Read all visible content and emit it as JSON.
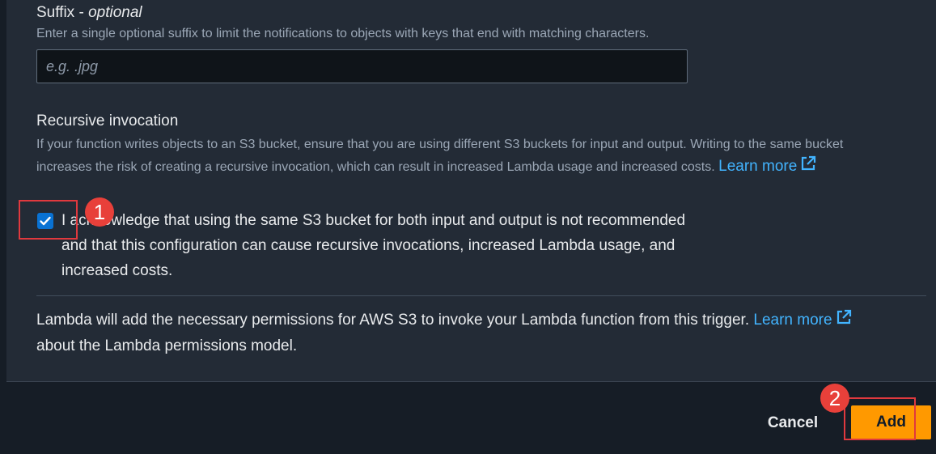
{
  "suffix": {
    "title": "Suffix - ",
    "title_optional": "optional",
    "description": "Enter a single optional suffix to limit the notifications to objects with keys that end with matching characters.",
    "placeholder": "e.g. .jpg",
    "value": ""
  },
  "recursive": {
    "title": "Recursive invocation",
    "description": "If your function writes objects to an S3 bucket, ensure that you are using different S3 buckets for input and output. Writing to the same bucket increases the risk of creating a recursive invocation, which can result in increased Lambda usage and increased costs.",
    "learn_more": "Learn more",
    "acknowledge_checked": true,
    "acknowledge_label": "I acknowledge that using the same S3 bucket for both input and output is not recommended and that this configuration can cause recursive invocations, increased Lambda usage, and increased costs."
  },
  "permissions": {
    "text_before": "Lambda will add the necessary permissions for AWS S3 to invoke your Lambda function from this trigger.",
    "learn_more": "Learn more",
    "text_after": "about the Lambda permissions model."
  },
  "footer": {
    "cancel_label": "Cancel",
    "add_label": "Add"
  },
  "annotations": {
    "badge_1": "1",
    "badge_2": "2"
  },
  "colors": {
    "background": "#161d26",
    "panel": "#232b36",
    "link": "#42b4ff",
    "primary_button": "#ff9900",
    "checkbox": "#0972d3",
    "annotation": "#e0393e"
  }
}
